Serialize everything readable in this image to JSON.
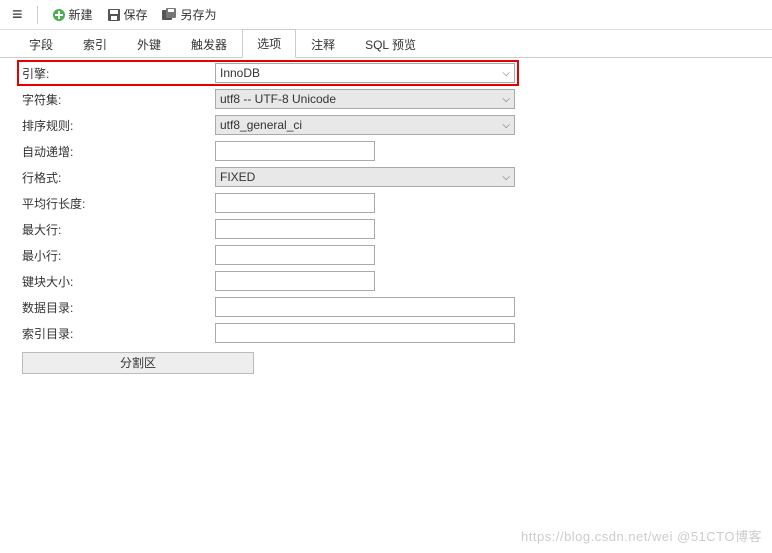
{
  "toolbar": {
    "new_label": "新建",
    "save_label": "保存",
    "save_as_label": "另存为"
  },
  "tabs": {
    "fields": "字段",
    "indexes": "索引",
    "foreign_keys": "外键",
    "triggers": "触发器",
    "options": "选项",
    "comment": "注释",
    "sql_preview": "SQL 预览"
  },
  "form": {
    "engine_label": "引擎:",
    "engine_value": "InnoDB",
    "charset_label": "字符集:",
    "charset_value": "utf8 -- UTF-8 Unicode",
    "collation_label": "排序规则:",
    "collation_value": "utf8_general_ci",
    "auto_increment_label": "自动递增:",
    "auto_increment_value": "",
    "row_format_label": "行格式:",
    "row_format_value": "FIXED",
    "avg_row_length_label": "平均行长度:",
    "avg_row_length_value": "",
    "max_rows_label": "最大行:",
    "max_rows_value": "",
    "min_rows_label": "最小行:",
    "min_rows_value": "",
    "key_block_size_label": "键块大小:",
    "key_block_size_value": "",
    "data_directory_label": "数据目录:",
    "data_directory_value": "",
    "index_directory_label": "索引目录:",
    "index_directory_value": "",
    "partition_button": "分割区"
  },
  "watermark": "https://blog.csdn.net/wei @51CTO博客"
}
